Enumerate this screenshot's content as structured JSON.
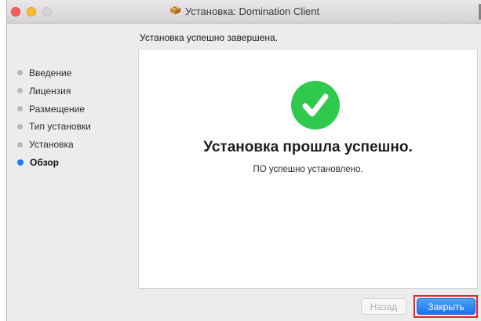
{
  "window": {
    "title": "Установка: Domination Client",
    "title_icon": "package-icon"
  },
  "header": {
    "status": "Установка успешно завершена."
  },
  "sidebar": {
    "items": [
      {
        "label": "Введение",
        "active": false
      },
      {
        "label": "Лицензия",
        "active": false
      },
      {
        "label": "Размещение",
        "active": false
      },
      {
        "label": "Тип установки",
        "active": false
      },
      {
        "label": "Установка",
        "active": false
      },
      {
        "label": "Обзор",
        "active": true
      }
    ]
  },
  "main": {
    "icon": "checkmark-icon",
    "title": "Установка прошла успешно.",
    "subtitle": "ПО успешно установлено."
  },
  "buttons": {
    "back_label": "Назад",
    "back_enabled": false,
    "close_label": "Закрыть"
  },
  "colors": {
    "accent": "#1f7cf3",
    "success": "#2fc94e",
    "highlight": "#e8202b"
  }
}
